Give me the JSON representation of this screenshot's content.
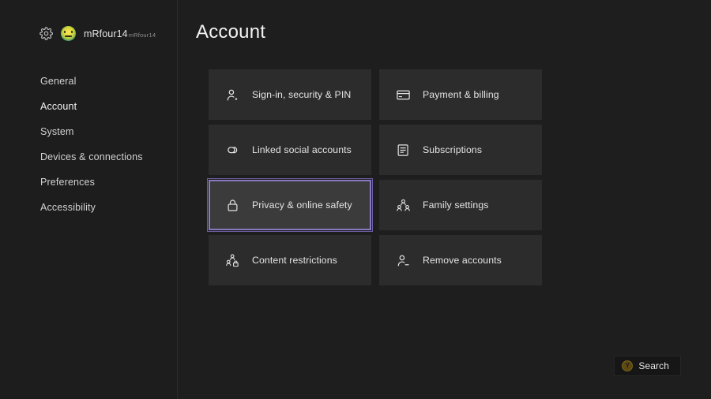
{
  "sidebar": {
    "profile": {
      "gear_icon": "gear-icon",
      "avatar_icon": "avatar",
      "gamertag": "mRfour14",
      "gamertag_suffix": "mRfour14"
    },
    "items": [
      {
        "label": "General",
        "active": false
      },
      {
        "label": "Account",
        "active": true
      },
      {
        "label": "System",
        "active": false
      },
      {
        "label": "Devices & connections",
        "active": false
      },
      {
        "label": "Preferences",
        "active": false
      },
      {
        "label": "Accessibility",
        "active": false
      }
    ]
  },
  "main": {
    "title": "Account",
    "tiles": [
      {
        "label": "Sign-in, security & PIN",
        "icon": "person-key-icon",
        "selected": false
      },
      {
        "label": "Payment & billing",
        "icon": "credit-card-icon",
        "selected": false
      },
      {
        "label": "Linked social accounts",
        "icon": "link-chain-icon",
        "selected": false
      },
      {
        "label": "Subscriptions",
        "icon": "subscription-document-icon",
        "selected": false
      },
      {
        "label": "Privacy & online safety",
        "icon": "lock-icon",
        "selected": true
      },
      {
        "label": "Family settings",
        "icon": "family-group-icon",
        "selected": false
      },
      {
        "label": "Content restrictions",
        "icon": "person-lock-icon",
        "selected": false
      },
      {
        "label": "Remove accounts",
        "icon": "person-remove-icon",
        "selected": false
      }
    ]
  },
  "footer": {
    "search_button_label": "Search",
    "search_button_glyph": "Y",
    "search_button_icon": "y-button-icon"
  },
  "colors": {
    "background": "#1e1e1e",
    "sidebar": "#1d1d1d",
    "tile": "#2c2c2c",
    "tile_selected": "#3b3b3b",
    "accent_border": "#8a79c0",
    "text_primary": "#e8e8e8",
    "y_button": "#5c4a12"
  }
}
